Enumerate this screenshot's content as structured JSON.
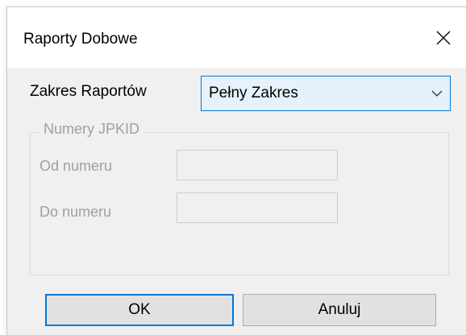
{
  "window": {
    "title": "Raporty Dobowe"
  },
  "icons": {
    "close": "close-icon",
    "dropdown": "chevron-down-icon"
  },
  "form": {
    "range_label": "Zakres Raportów",
    "range_selected": "Pełny Zakres"
  },
  "group": {
    "title": "Numery JPKID",
    "from_label": "Od numeru",
    "from_value": "",
    "to_label": "Do numeru",
    "to_value": ""
  },
  "buttons": {
    "ok": "OK",
    "cancel": "Anuluj"
  },
  "colors": {
    "accent": "#0078d7",
    "disabled_text": "#a0a0a0"
  }
}
